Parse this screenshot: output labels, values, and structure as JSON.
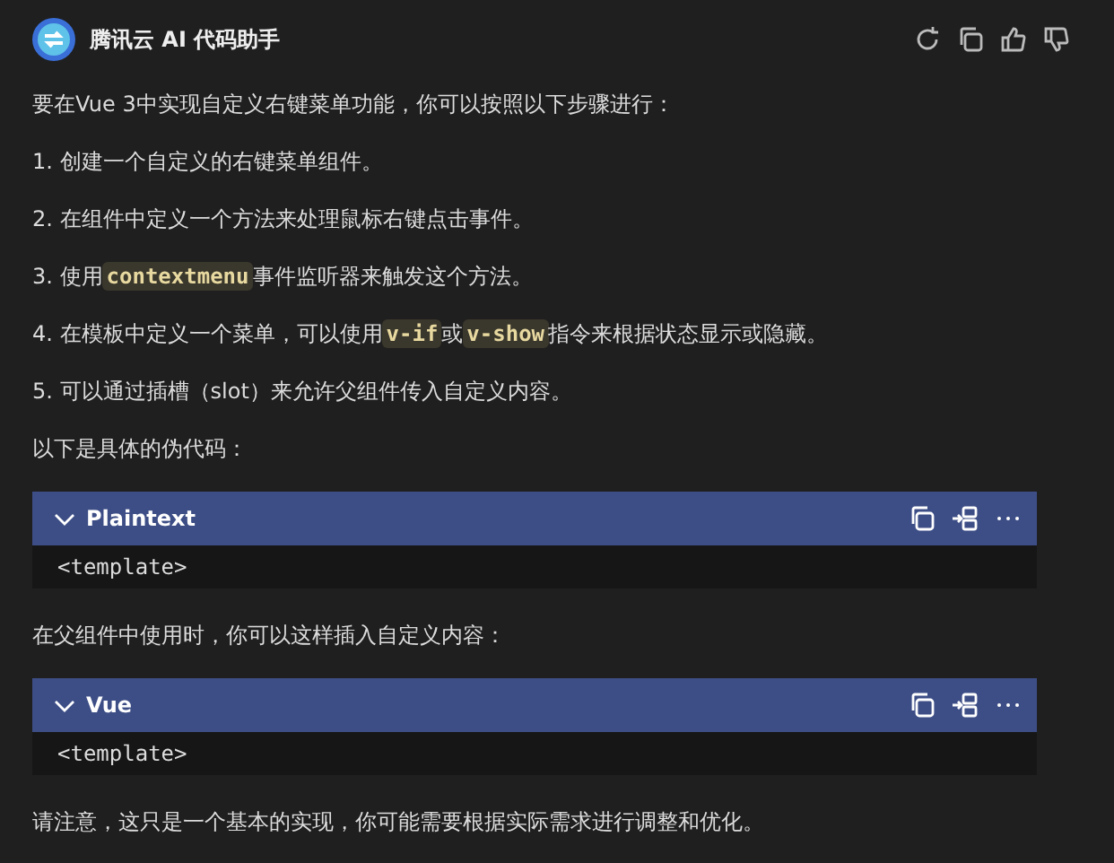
{
  "header": {
    "title": "腾讯云 AI 代码助手"
  },
  "blocks": [
    {
      "kind": "text",
      "parts": [
        {
          "text": "要在Vue 3中实现自定义右键菜单功能，你可以按照以下步骤进行：",
          "code": false
        }
      ]
    },
    {
      "kind": "text",
      "parts": [
        {
          "text": "1. 创建一个自定义的右键菜单组件。",
          "code": false
        }
      ]
    },
    {
      "kind": "text",
      "parts": [
        {
          "text": "2. 在组件中定义一个方法来处理鼠标右键点击事件。",
          "code": false
        }
      ]
    },
    {
      "kind": "text",
      "parts": [
        {
          "text": "3. 使用",
          "code": false
        },
        {
          "text": "contextmenu",
          "code": true
        },
        {
          "text": "事件监听器来触发这个方法。",
          "code": false
        }
      ]
    },
    {
      "kind": "text",
      "parts": [
        {
          "text": "4. 在模板中定义一个菜单，可以使用",
          "code": false
        },
        {
          "text": "v-if",
          "code": true
        },
        {
          "text": "或",
          "code": false
        },
        {
          "text": "v-show",
          "code": true
        },
        {
          "text": "指令来根据状态显示或隐藏。",
          "code": false
        }
      ]
    },
    {
      "kind": "text",
      "parts": [
        {
          "text": "5. 可以通过插槽（slot）来允许父组件传入自定义内容。",
          "code": false
        }
      ]
    },
    {
      "kind": "text",
      "parts": [
        {
          "text": "以下是具体的伪代码：",
          "code": false
        }
      ]
    },
    {
      "kind": "code",
      "language": "Plaintext",
      "expanded": true,
      "code": "<template>"
    },
    {
      "kind": "text",
      "parts": [
        {
          "text": "在父组件中使用时，你可以这样插入自定义内容：",
          "code": false
        }
      ]
    },
    {
      "kind": "code",
      "language": "Vue",
      "expanded": true,
      "code": "<template>"
    },
    {
      "kind": "text",
      "parts": [
        {
          "text": "请注意，这只是一个基本的实现，你可能需要根据实际需求进行调整和优化。",
          "code": false
        }
      ]
    }
  ]
}
